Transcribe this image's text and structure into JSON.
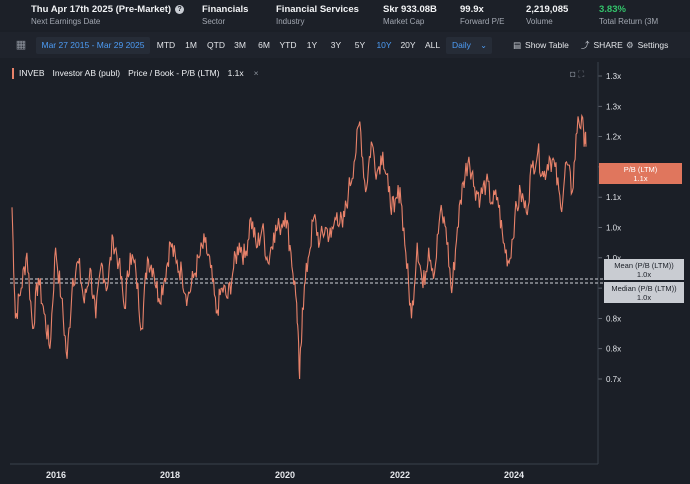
{
  "stats": [
    {
      "value": "Thu Apr 17th 2025 (Pre-Market)",
      "label": "Next Earnings Date",
      "info_icon": true
    },
    {
      "value": "Financials",
      "label": "Sector"
    },
    {
      "value": "Financial Services",
      "label": "Industry"
    },
    {
      "value": "Skr 933.08B",
      "label": "Market Cap"
    },
    {
      "value": "99.9x",
      "label": "Forward P/E"
    },
    {
      "value": "2,219,085",
      "label": "Volume"
    },
    {
      "value": "3.83%",
      "label": "Total Return (3M",
      "color": "#33c36b"
    }
  ],
  "toolbar": {
    "date_range": "Mar 27 2015 - Mar 29 2025",
    "ranges": [
      "MTD",
      "1M",
      "QTD",
      "3M",
      "6M",
      "YTD",
      "1Y",
      "3Y",
      "5Y",
      "10Y",
      "20Y",
      "ALL"
    ],
    "active_range": "10Y",
    "interval": "Daily",
    "show_table": "Show Table",
    "share": "SHARE",
    "settings": "Settings"
  },
  "legend": {
    "ticker": "INVEB",
    "company": "Investor AB (publ)",
    "metric": "Price / Book - P/B (LTM)",
    "value": "1.1x",
    "close": "×"
  },
  "tags": {
    "current_title": "P/B (LTM)",
    "current_value": "1.1x",
    "mean_title": "Mean (P/B (LTM))",
    "mean_value": "1.0x",
    "median_title": "Median (P/B (LTM))",
    "median_value": "1.0x"
  },
  "chart_data": {
    "type": "line",
    "title": "",
    "xlabel": "",
    "ylabel": "",
    "x_ticks": [
      "2016",
      "2018",
      "2020",
      "2022",
      "2024"
    ],
    "y_ticks": [
      "1.3x",
      "1.3x",
      "1.2x",
      "1.1x",
      "1.1x",
      "1.0x",
      "1.0x",
      "0.9x",
      "0.8x",
      "0.8x",
      "0.7x"
    ],
    "ylim": [
      0.68,
      1.33
    ],
    "mean": 0.99,
    "median": 0.985,
    "color": "#e8826a",
    "series": [
      {
        "x": [
          2015.24,
          2015.3,
          2015.4,
          2015.5,
          2015.6,
          2015.7,
          2015.8,
          2015.9,
          2016.0,
          2016.1,
          2016.2,
          2016.3,
          2016.4,
          2016.5,
          2016.6,
          2016.7,
          2016.8,
          2016.9,
          2017.0,
          2017.1,
          2017.2,
          2017.3,
          2017.4,
          2017.5,
          2017.6,
          2017.7,
          2017.8,
          2017.9,
          2018.0,
          2018.1,
          2018.2,
          2018.3,
          2018.4,
          2018.5,
          2018.6,
          2018.7,
          2018.8,
          2018.9,
          2019.0,
          2019.1,
          2019.2,
          2019.3,
          2019.4,
          2019.5,
          2019.6,
          2019.7,
          2019.8,
          2019.9,
          2020.0,
          2020.1,
          2020.2,
          2020.25,
          2020.3,
          2020.4,
          2020.5,
          2020.6,
          2020.7,
          2020.8,
          2020.9,
          2021.0,
          2021.1,
          2021.2,
          2021.3,
          2021.4,
          2021.5,
          2021.6,
          2021.7,
          2021.8,
          2021.9,
          2022.0,
          2022.1,
          2022.2,
          2022.3,
          2022.4,
          2022.5,
          2022.6,
          2022.7,
          2022.8,
          2022.9,
          2023.0,
          2023.1,
          2023.2,
          2023.3,
          2023.4,
          2023.5,
          2023.6,
          2023.7,
          2023.8,
          2023.9,
          2024.0,
          2024.1,
          2024.2,
          2024.3,
          2024.4,
          2024.5,
          2024.6,
          2024.7,
          2024.8,
          2024.9,
          2025.0,
          2025.1,
          2025.2,
          2025.24
        ],
        "y": [
          1.04,
          0.82,
          0.88,
          0.95,
          0.8,
          0.9,
          0.83,
          0.76,
          0.96,
          0.86,
          0.74,
          0.9,
          0.93,
          0.85,
          0.92,
          0.82,
          0.93,
          0.88,
          0.98,
          0.93,
          0.84,
          0.95,
          0.91,
          0.8,
          0.94,
          0.92,
          0.86,
          0.9,
          0.97,
          0.93,
          0.91,
          0.86,
          0.9,
          0.94,
          0.97,
          0.92,
          0.83,
          0.88,
          0.86,
          0.92,
          0.97,
          0.94,
          1.02,
          0.96,
          1.0,
          0.93,
          0.99,
          1.0,
          1.03,
          0.95,
          0.85,
          0.7,
          0.84,
          0.94,
          1.02,
          0.97,
          1.0,
          0.98,
          1.03,
          1.0,
          1.07,
          1.13,
          1.21,
          1.07,
          1.17,
          1.11,
          1.15,
          1.07,
          1.03,
          1.08,
          0.95,
          0.82,
          0.97,
          0.88,
          0.96,
          0.91,
          1.03,
          1.0,
          0.87,
          1.0,
          1.09,
          1.14,
          1.08,
          1.06,
          1.09,
          1.05,
          1.06,
          0.97,
          0.93,
          1.02,
          1.07,
          1.03,
          1.12,
          1.15,
          1.1,
          1.14,
          1.12,
          1.04,
          1.13,
          1.07,
          1.22,
          1.19,
          1.16
        ]
      }
    ]
  }
}
